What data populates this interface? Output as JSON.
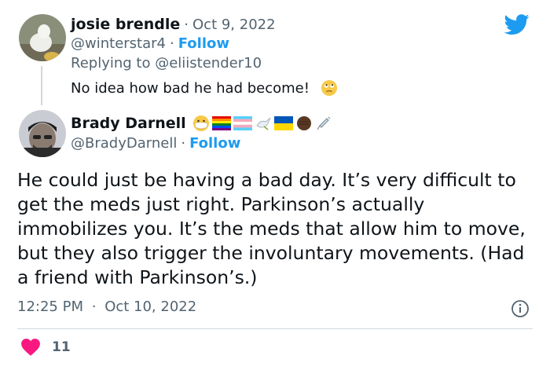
{
  "parent_tweet": {
    "author_name": "josie brendle",
    "separator": "·",
    "date": "Oct 9, 2022",
    "handle": "@winterstar4",
    "follow_label": "Follow",
    "replying_to_label": "Replying to",
    "replying_to_handle": "@eliistender10",
    "text": "No idea how bad he had become!",
    "emoji": "rolling-eyes-face-icon"
  },
  "main_tweet": {
    "author_name": "Brady Darnell",
    "name_emojis": [
      "mask-face-icon",
      "rainbow-flag-icon",
      "transgender-flag-icon",
      "dove-icon",
      "ukraine-flag-icon",
      "raised-fist-icon",
      "syringe-icon"
    ],
    "handle": "@BradyDarnell",
    "separator": "·",
    "follow_label": "Follow",
    "text": "He could just be having a bad day. It’s very difficult to get the meds just right. Parkinson’s actually immobilizes you. It’s the meds that allow him to move, but they also trigger the involuntary movements. (Had a friend with Parkinson’s.)",
    "time": "12:25 PM",
    "date": "Oct 10, 2022",
    "like_count": "11"
  },
  "colors": {
    "accent": "#1d9bf0",
    "secondary_text": "#536471",
    "heart": "#f91880"
  }
}
